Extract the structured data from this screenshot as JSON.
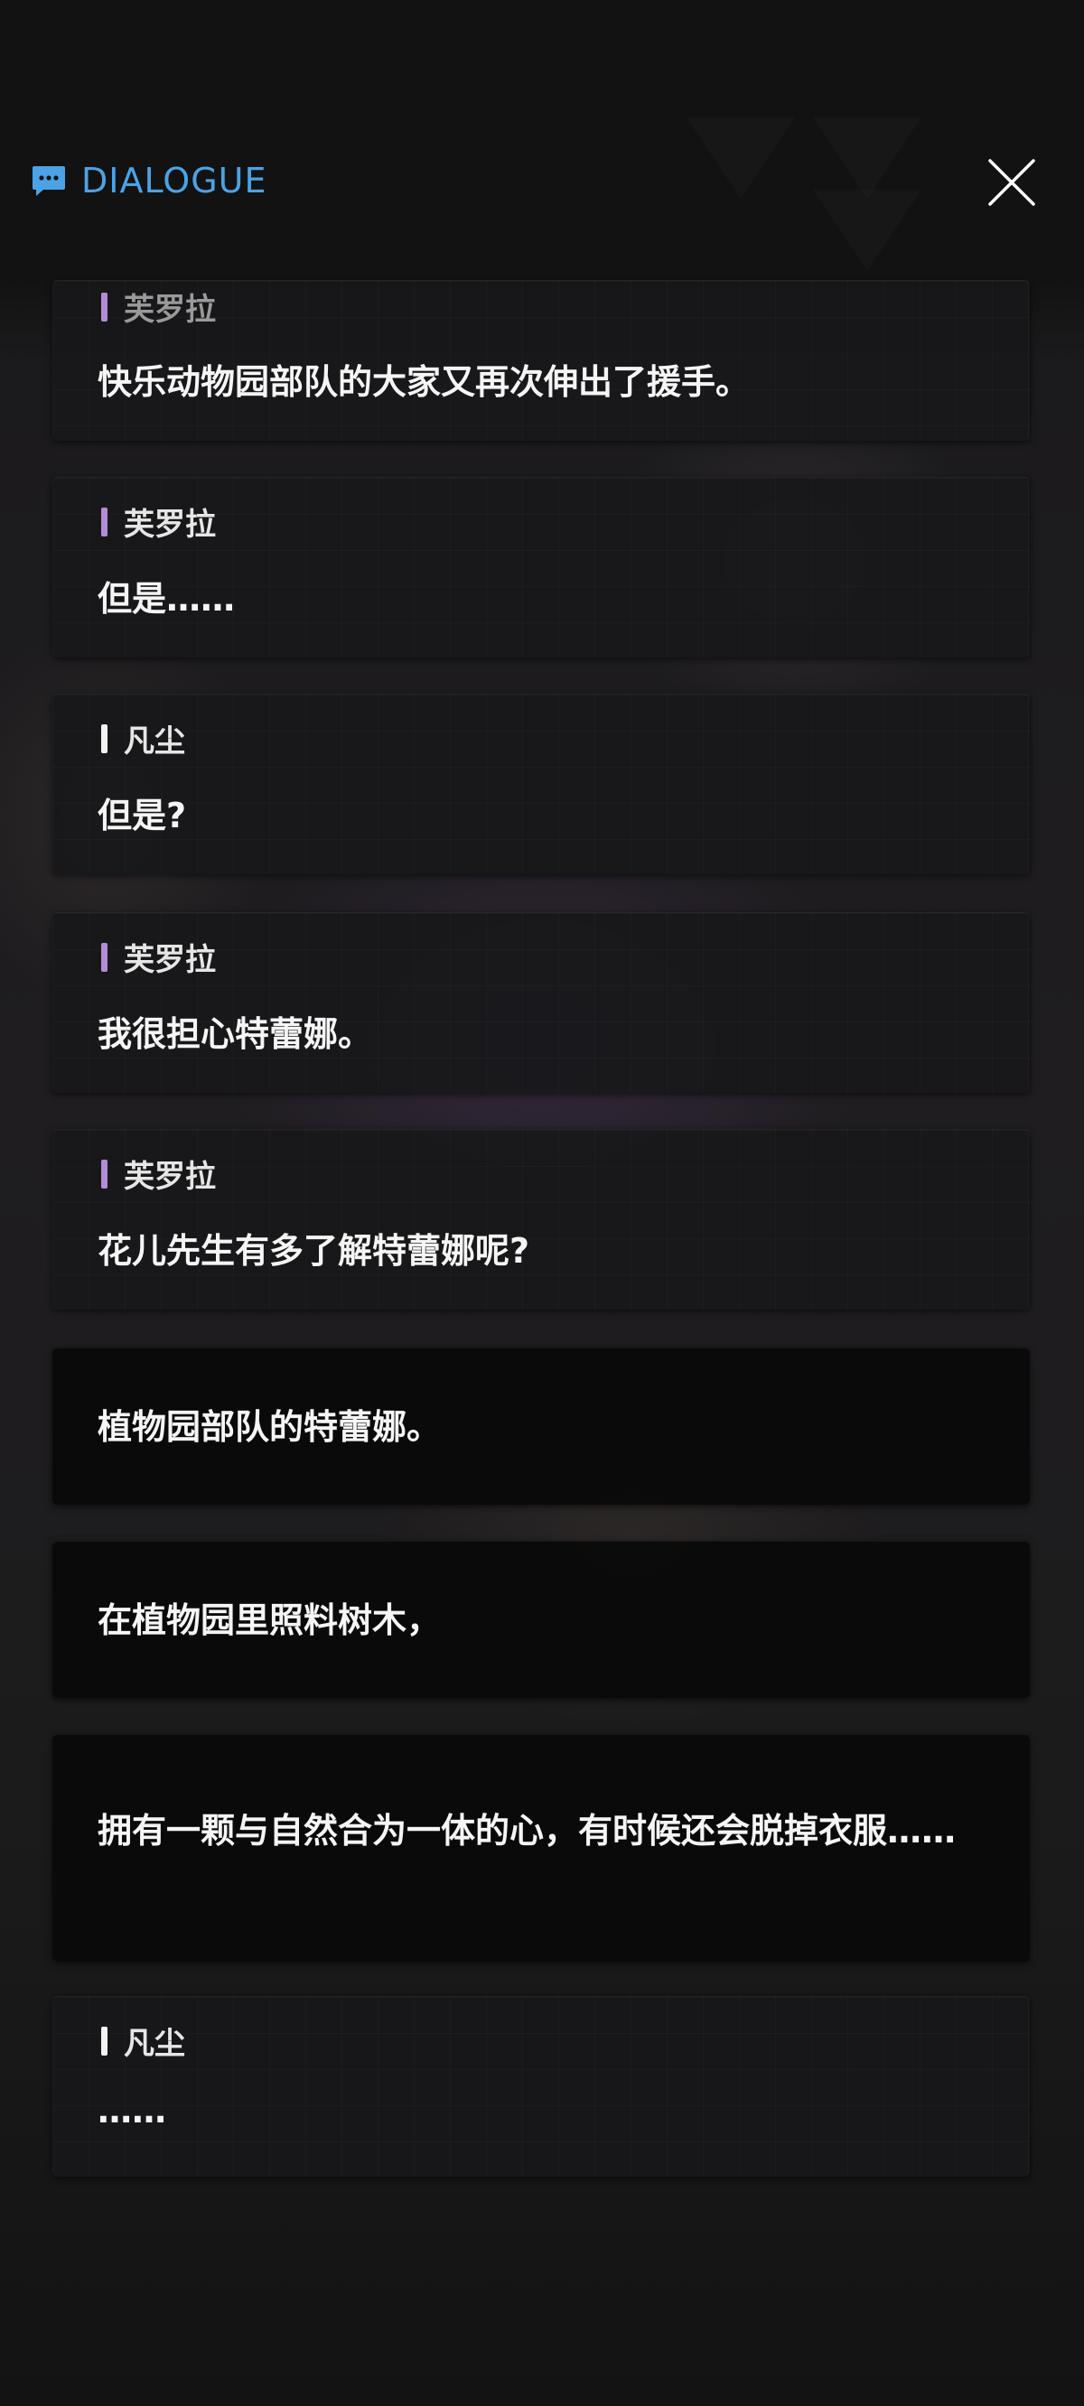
{
  "header": {
    "title": "DIALOGUE",
    "icon": "chat-bubble-icon",
    "accent_color": "#4aa3e6",
    "close_icon": "close-icon"
  },
  "speaker_colors": {
    "芙罗拉": "#b48cd6",
    "凡尘": "#f2f2f2"
  },
  "entries": [
    {
      "speaker": "芙罗拉",
      "text": "快乐动物园部队的大家又再次伸出了援手。"
    },
    {
      "speaker": "芙罗拉",
      "text": "但是……"
    },
    {
      "speaker": "凡尘",
      "text": "但是?"
    },
    {
      "speaker": "芙罗拉",
      "text": "我很担心特蕾娜。"
    },
    {
      "speaker": "芙罗拉",
      "text": "花儿先生有多了解特蕾娜呢?"
    },
    {
      "speaker": "",
      "text": "植物园部队的特蕾娜。"
    },
    {
      "speaker": "",
      "text": "在植物园里照料树木，"
    },
    {
      "speaker": "",
      "text": "拥有一颗与自然合为一体的心，有时候还会脱掉衣服……"
    },
    {
      "speaker": "凡尘",
      "text": "……"
    }
  ]
}
